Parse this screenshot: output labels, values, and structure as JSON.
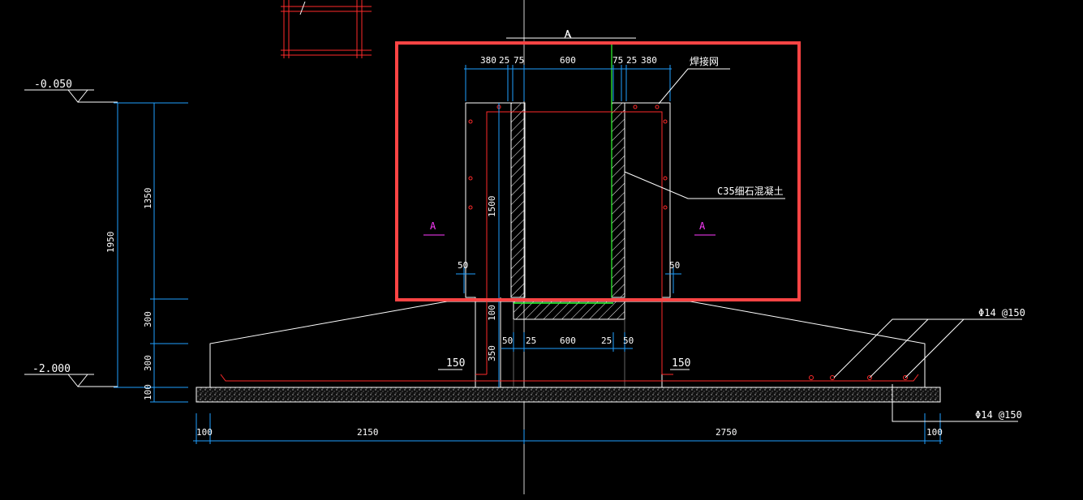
{
  "levels": {
    "top": "-0.050",
    "bottom": "-2.000"
  },
  "left_dims": {
    "d1350": "1350",
    "d1950": "1950",
    "d300a": "300",
    "d300b": "300",
    "d100": "100"
  },
  "top_dims": {
    "d380l": "380",
    "d25l": "25",
    "d75l": "75",
    "d600": "600",
    "d75r": "75",
    "d25r": "25",
    "d380r": "380"
  },
  "inner_dims": {
    "d1500": "1500",
    "d50l": "50",
    "d50r": "50",
    "d100": "100",
    "d350": "350"
  },
  "under_dims": {
    "d50l": "50",
    "d25l": "25",
    "d600": "600",
    "d25r": "25",
    "d50r": "50"
  },
  "bottom_dims": {
    "d100l": "100",
    "d2150": "2150",
    "d2750": "2750",
    "d100r": "100"
  },
  "labels": {
    "weld_mesh": "焊接网",
    "concrete": "C35细石混凝土",
    "section_left": "A",
    "section_right": "A",
    "section_top": "A",
    "off150_left": "150",
    "off150_right": "150",
    "rebar_top": "Φ14 @150",
    "rebar_bottom": "Φ14 @150"
  },
  "colors": {
    "dim": "#1f9fff",
    "rebar": "#ff2a2a",
    "outline": "#ffffff",
    "highlight": "#ff4444",
    "green": "#33ff33",
    "magenta": "#ff3cff"
  }
}
